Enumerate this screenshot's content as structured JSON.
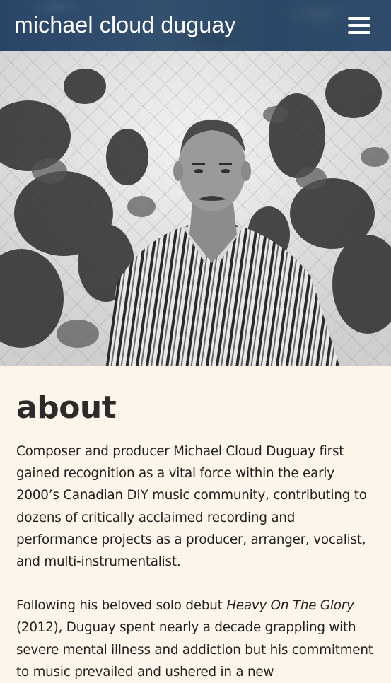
{
  "header": {
    "site_title": "michael cloud duguay",
    "menu_icon": "hamburger-menu-icon"
  },
  "hero": {
    "description_icon": "portrait-photo"
  },
  "about": {
    "heading": "about",
    "p1": "Composer and producer Michael Cloud Duguay first gained recognition as a vital force within the early 2000’s Canadian DIY music community, contributing to dozens of critically acclaimed recording and performance projects as a producer, arranger, vocalist, and multi-instrumentalist.",
    "p2_before": "Following his beloved solo debut ",
    "p2_title": "Heavy On The Glory",
    "p2_after": " (2012), Duguay spent nearly a decade grappling with severe mental illness and addiction but his commitment to music prevailed and ushered in a new"
  },
  "colors": {
    "header_bg": "#2f4a6b",
    "page_bg": "#fdf5ea",
    "text": "#1f1f1f"
  }
}
